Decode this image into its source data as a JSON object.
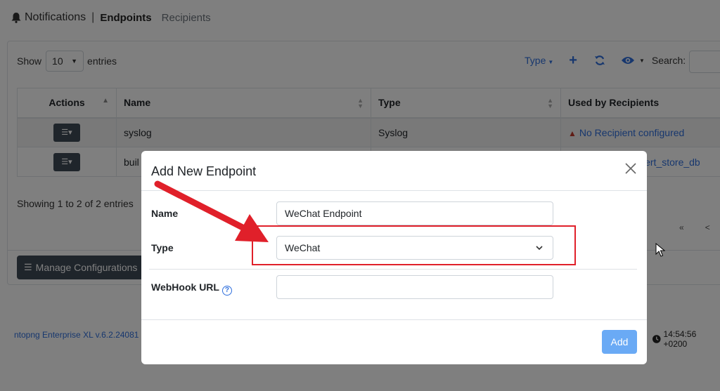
{
  "breadcrumb": {
    "root": "Notifications",
    "separator": "|",
    "active": "Endpoints",
    "other": "Recipients"
  },
  "table_controls": {
    "show_label": "Show",
    "entries_value": "10",
    "entries_label": "entries",
    "type_filter": "Type",
    "search_label": "Search:"
  },
  "table": {
    "headers": [
      "Actions",
      "Name",
      "Type",
      "Used by Recipients"
    ],
    "rows": [
      {
        "name": "syslog",
        "type": "Syslog",
        "recipients": "No Recipient configured"
      },
      {
        "name": "buil",
        "type": "",
        "recipients": "lert_store_db"
      }
    ],
    "info": "Showing 1 to 2 of 2 entries",
    "pager": [
      "«",
      "<"
    ]
  },
  "manage_button": "Manage Configurations",
  "footer": {
    "version": "ntopng Enterprise XL v.6.2.24081",
    "time": "14:54:56 +0200"
  },
  "modal": {
    "title": "Add New Endpoint",
    "fields": {
      "name_label": "Name",
      "name_value": "WeChat Endpoint",
      "type_label": "Type",
      "type_value": "WeChat",
      "webhook_label": "WebHook URL",
      "webhook_value": ""
    },
    "add_button": "Add"
  },
  "colors": {
    "accent": "#2f6fdd",
    "highlight": "#e0202a",
    "dark_button": "#3f4a56",
    "add_button": "#6aaaf5"
  }
}
